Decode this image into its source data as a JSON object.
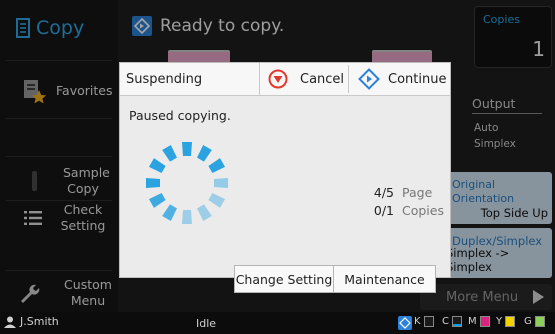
{
  "app": {
    "title": "Copy"
  },
  "status": {
    "message": "Ready to copy."
  },
  "copies": {
    "label": "Copies",
    "value": "1"
  },
  "sidebar": {
    "items": [
      {
        "label": "Favorites"
      },
      {
        "label": "Sample Copy"
      },
      {
        "label": "Check Setting"
      },
      {
        "label": "Custom Menu"
      }
    ]
  },
  "settings": {
    "output": {
      "label": "Output",
      "value1": "Auto",
      "value2": "Simplex"
    },
    "orientation": {
      "label_line1": "Original",
      "label_line2": "Orientation",
      "value": "Top Side Up"
    },
    "duplex": {
      "label": "Duplex/Simplex",
      "value": "Simplex -> Simplex"
    },
    "more_menu": {
      "label": "More Menu"
    }
  },
  "statusbar": {
    "user": "J.Smith",
    "state": "Idle",
    "inks": [
      "K",
      "C",
      "M",
      "Y",
      "G"
    ],
    "ink_colors": {
      "C": "#00a0e0",
      "M": "#d8257f",
      "Y": "#f2d200",
      "G": "#8ccf5a"
    }
  },
  "dialog": {
    "title": "Suspending",
    "cancel_label": "Cancel",
    "continue_label": "Continue",
    "message": "Paused copying.",
    "pages": {
      "count": "4/5",
      "unit": "Page"
    },
    "copies": {
      "count": "0/1",
      "unit": "Copies"
    },
    "change_setting_label": "Change Setting",
    "maintenance_label": "Maintenance"
  },
  "colors": {
    "accent": "#2fa8e8",
    "cancel_red": "#e03a2e",
    "continue_blue": "#2b82d8",
    "spinner": "#2aa3e0"
  }
}
